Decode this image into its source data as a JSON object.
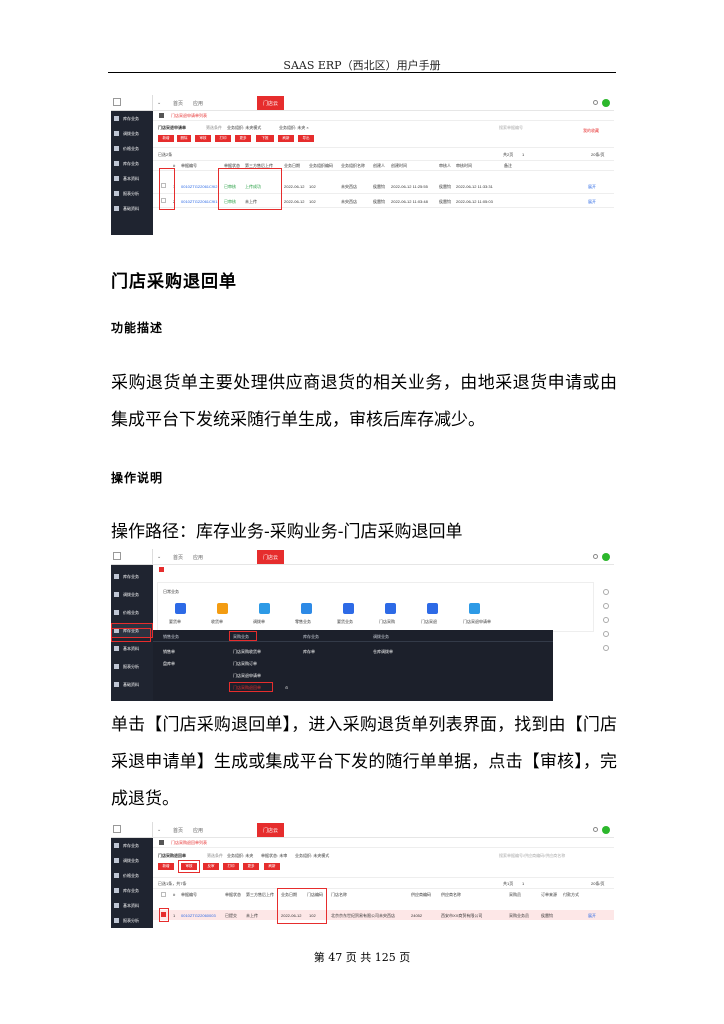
{
  "header": {
    "title": "SAAS ERP（西北区）用户手册"
  },
  "section": {
    "title": "门店采购退回单"
  },
  "func": {
    "title": "功能描述",
    "para": "采购退货单主要处理供应商退货的相关业务，由地采退货申请或由集成平台下发统采随行单生成，审核后库存减少。"
  },
  "ops": {
    "title": "操作说明",
    "path": "操作路径：库存业务-采购业务-门店采购退回单",
    "para": "单击【门店采购退回单】，进入采购退货单列表界面，找到由【门店采退申请单】生成或集成平台下发的随行单单据，点击【审核】，完成退货。"
  },
  "footer": {
    "text": "第 47 页 共 125 页"
  },
  "shot1": {
    "nav_home": "首页",
    "nav_app": "应用",
    "tab": "门店云",
    "sidebar": [
      "库存业务",
      "调拨业务",
      "价格业务",
      "库存业务",
      "基本资料",
      "报表分析",
      "基础资料"
    ],
    "breadcrumb": "门店采退申请单列表",
    "page_title": "门店采退申请单",
    "filters": [
      "筛选条件",
      "业务组织: 未央模式",
      "业务组织: 未央 ×"
    ],
    "search_placeholder": "搜索单据编号",
    "fav": "我的收藏",
    "buttons": [
      "新增",
      "删除",
      "审核",
      "打印",
      "更多",
      "下推",
      "刷新",
      "导出"
    ],
    "summary": "已选2条",
    "pager": "共2页",
    "page_no": "1",
    "per_page": "20条/页",
    "columns": [
      "#",
      "单据编号",
      "单据状态",
      "第三方售后上传",
      "业务日期",
      "业务组织编码",
      "业务组织名称",
      "创建人",
      "创建时间",
      "审核人",
      "审核时间",
      "备注"
    ],
    "rows": [
      [
        "1",
        "0010ZTG22061C9I2",
        "已审核",
        "上传成功",
        "2022-06-12",
        "102",
        "未央西店",
        "侯雷钧",
        "2022-06-12 11:25:55",
        "侯雷钧",
        "2022-06-12 11:33:31",
        "",
        "展开"
      ],
      [
        "2",
        "0010ZTG22061C9I1",
        "已审核",
        "未上传",
        "2022-06-12",
        "102",
        "未央西店",
        "侯雷钧",
        "2022-06-12 11:03:48",
        "侯雷钧",
        "2022-06-12 11:05:03",
        "",
        "展开"
      ]
    ]
  },
  "shot2": {
    "nav_home": "首页",
    "nav_app": "应用",
    "tab": "门店云",
    "sidebar": [
      "库存业务",
      "调拨业务",
      "价格业务",
      "库存业务",
      "基本资料",
      "报表分析",
      "基础资料"
    ],
    "panel_title": "日常业务",
    "icons": [
      "要货单",
      "收货单",
      "调拨单",
      "零售业务",
      "要货业务",
      "门店采购",
      "门店采退",
      "门店采退申请单"
    ],
    "icon_colors": [
      "#2d6ae6",
      "#f39c12",
      "#2d9ae6",
      "#2d8ae6",
      "#2d6ae6",
      "#2d6ae6",
      "#2d6ae6",
      "#2d9ae6"
    ],
    "menu_headers": [
      "销售业务",
      "采购业务",
      "库存业务",
      "调拨业务"
    ],
    "menu_col1": [
      "销售单",
      "盘库单"
    ],
    "menu_col2": [
      "门店采购收货单",
      "门店采购订单",
      "门店采购退回单",
      "门店采退申请单"
    ],
    "menu_col3": [
      "库存单"
    ],
    "menu_col4": [
      "仓库调拨单"
    ]
  },
  "shot3": {
    "nav_home": "首页",
    "nav_app": "应用",
    "tab": "门店云",
    "sidebar": [
      "库存业务",
      "调拨业务",
      "价格业务",
      "库存业务",
      "基本资料",
      "报表分析"
    ],
    "breadcrumb": "门店采购退回单列表",
    "page_title": "门店采购退回单",
    "filters": [
      "筛选条件",
      "业务组织: 未央",
      "单据状态: 未审",
      "业务组织: 未央模式"
    ],
    "search_placeholder": "搜索单据编号/供应商编码/供应商名称",
    "buttons": [
      "新增",
      "审核",
      "反审",
      "打印",
      "更多",
      "刷新"
    ],
    "summary": "已选1条，共7条",
    "pager": "共1页",
    "page_no": "1",
    "per_page": "20条/页",
    "columns": [
      "#",
      "单据编号",
      "单据状态",
      "第三方售后上传",
      "业务日期",
      "门店编码",
      "门店名称",
      "供应商编码",
      "供应商名称",
      "采购员",
      "订单来源",
      "付款方式"
    ],
    "row": [
      "1",
      "0010ZTG22060003",
      "已提交",
      "未上传",
      "2022-06-12",
      "102",
      "北京京东世纪贸易有限公司未央西店",
      "24052",
      "西安市XX商贸有限公司",
      "采购业务员",
      "侯雷钧",
      "",
      "展开"
    ]
  }
}
